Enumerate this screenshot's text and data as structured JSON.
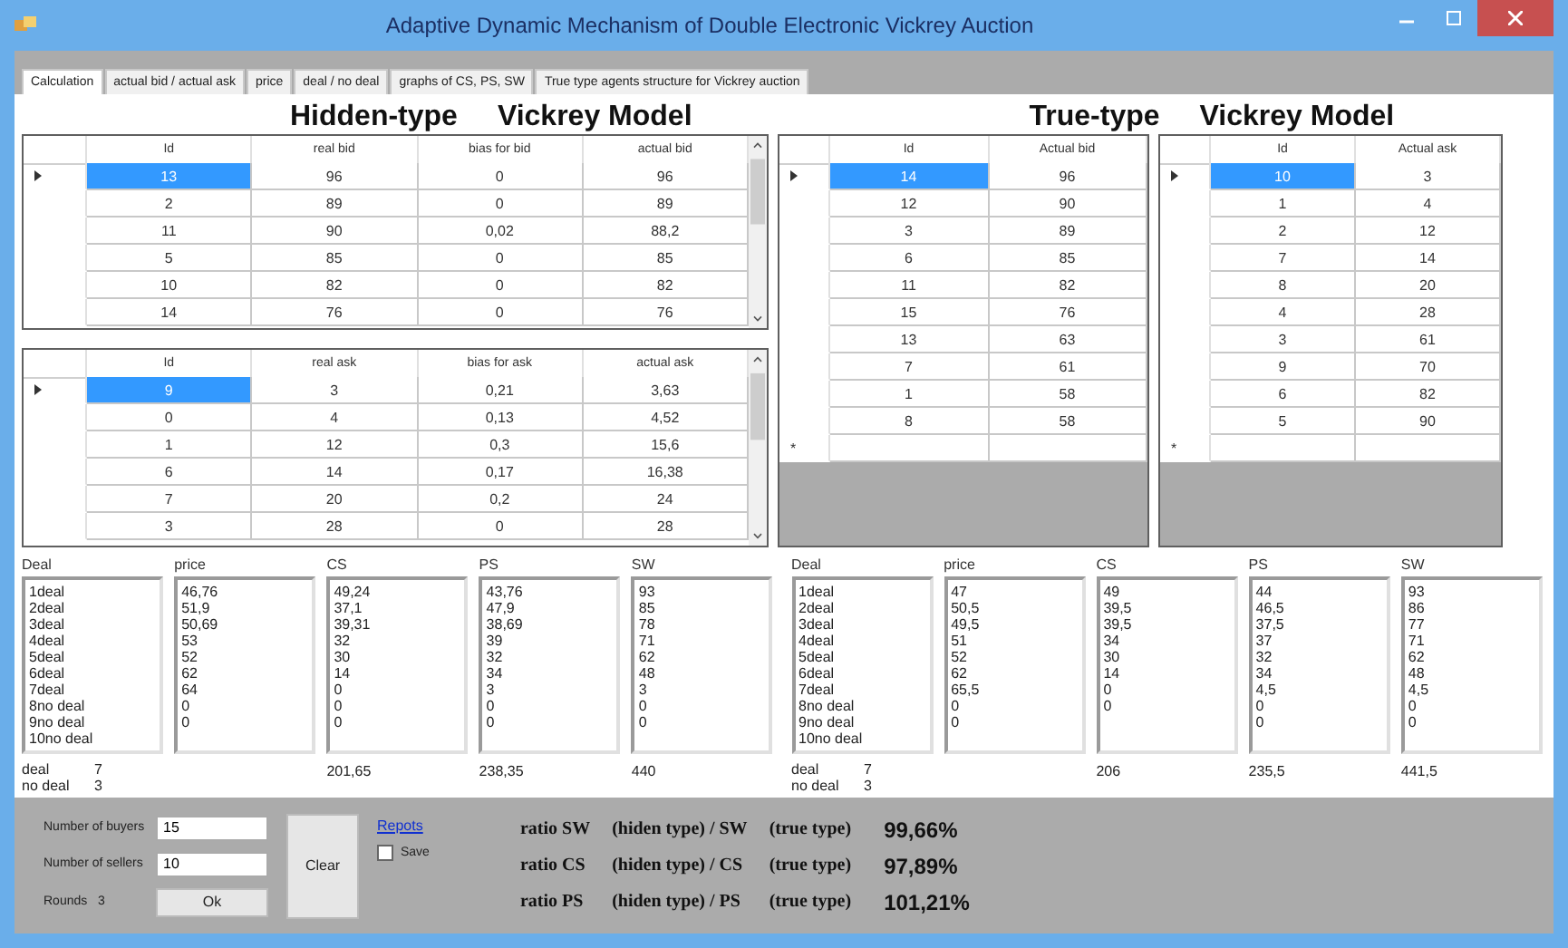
{
  "window": {
    "title": "Adaptive Dynamic Mechanism of Double Electronic Vickrey Auction"
  },
  "tabs": [
    {
      "label": "Calculation",
      "selected": true
    },
    {
      "label": "actual bid / actual ask",
      "selected": false
    },
    {
      "label": "price",
      "selected": false
    },
    {
      "label": "deal / no deal",
      "selected": false
    },
    {
      "label": "graphs of CS, PS, SW",
      "selected": false
    },
    {
      "label": "True type agents structure for Vickrey auction",
      "selected": false
    }
  ],
  "hidden_type": {
    "title": [
      "Hidden-type",
      "Vickrey Model"
    ],
    "bid_table": {
      "columns": [
        "Id",
        "real bid",
        "bias for bid",
        "actual bid"
      ],
      "rows": [
        {
          "cells": [
            "13",
            "96",
            "0",
            "96"
          ],
          "selected": true
        },
        {
          "cells": [
            "2",
            "89",
            "0",
            "89"
          ],
          "selected": false
        },
        {
          "cells": [
            "11",
            "90",
            "0,02",
            "88,2"
          ],
          "selected": false
        },
        {
          "cells": [
            "5",
            "85",
            "0",
            "85"
          ],
          "selected": false
        },
        {
          "cells": [
            "10",
            "82",
            "0",
            "82"
          ],
          "selected": false
        },
        {
          "cells": [
            "14",
            "76",
            "0",
            "76"
          ],
          "selected": false
        }
      ]
    },
    "ask_table": {
      "columns": [
        "Id",
        "real ask",
        "bias for ask",
        "actual ask"
      ],
      "rows": [
        {
          "cells": [
            "9",
            "3",
            "0,21",
            "3,63"
          ],
          "selected": true
        },
        {
          "cells": [
            "0",
            "4",
            "0,13",
            "4,52"
          ],
          "selected": false
        },
        {
          "cells": [
            "1",
            "12",
            "0,3",
            "15,6"
          ],
          "selected": false
        },
        {
          "cells": [
            "6",
            "14",
            "0,17",
            "16,38"
          ],
          "selected": false
        },
        {
          "cells": [
            "7",
            "20",
            "0,2",
            "24"
          ],
          "selected": false
        },
        {
          "cells": [
            "3",
            "28",
            "0",
            "28"
          ],
          "selected": false
        }
      ]
    }
  },
  "true_type": {
    "title": [
      "True-type",
      "Vickrey Model"
    ],
    "bid_table": {
      "columns": [
        "Id",
        "Actual bid"
      ],
      "new_row_marker": "*",
      "rows": [
        {
          "cells": [
            "14",
            "96"
          ],
          "selected": true
        },
        {
          "cells": [
            "12",
            "90"
          ],
          "selected": false
        },
        {
          "cells": [
            "3",
            "89"
          ],
          "selected": false
        },
        {
          "cells": [
            "6",
            "85"
          ],
          "selected": false
        },
        {
          "cells": [
            "11",
            "82"
          ],
          "selected": false
        },
        {
          "cells": [
            "15",
            "76"
          ],
          "selected": false
        },
        {
          "cells": [
            "13",
            "63"
          ],
          "selected": false
        },
        {
          "cells": [
            "7",
            "61"
          ],
          "selected": false
        },
        {
          "cells": [
            "1",
            "58"
          ],
          "selected": false
        },
        {
          "cells": [
            "8",
            "58"
          ],
          "selected": false
        }
      ]
    },
    "ask_table": {
      "columns": [
        "Id",
        "Actual ask"
      ],
      "new_row_marker": "*",
      "rows": [
        {
          "cells": [
            "10",
            "3"
          ],
          "selected": true
        },
        {
          "cells": [
            "1",
            "4"
          ],
          "selected": false
        },
        {
          "cells": [
            "2",
            "12"
          ],
          "selected": false
        },
        {
          "cells": [
            "7",
            "14"
          ],
          "selected": false
        },
        {
          "cells": [
            "8",
            "20"
          ],
          "selected": false
        },
        {
          "cells": [
            "4",
            "28"
          ],
          "selected": false
        },
        {
          "cells": [
            "3",
            "61"
          ],
          "selected": false
        },
        {
          "cells": [
            "9",
            "70"
          ],
          "selected": false
        },
        {
          "cells": [
            "6",
            "82"
          ],
          "selected": false
        },
        {
          "cells": [
            "5",
            "90"
          ],
          "selected": false
        }
      ]
    }
  },
  "results": [
    {
      "deal_label": "deal",
      "deal_count": "7",
      "no_deal_label": "no deal",
      "no_deal_count": "3",
      "lists": [
        {
          "header": "Deal",
          "items": [
            "1deal",
            "2deal",
            "3deal",
            "4deal",
            "5deal",
            "6deal",
            "7deal",
            "8no deal",
            "9no deal",
            "10no deal"
          ]
        },
        {
          "header": "price",
          "items": [
            "46,76",
            "51,9",
            "50,69",
            "53",
            "52",
            "62",
            "64",
            "0",
            "0"
          ]
        },
        {
          "header": "CS",
          "items": [
            "49,24",
            "37,1",
            "39,31",
            "32",
            "30",
            "14",
            "0",
            "0",
            "0"
          ],
          "total": "201,65"
        },
        {
          "header": "PS",
          "items": [
            "43,76",
            "47,9",
            "38,69",
            "39",
            "32",
            "34",
            "3",
            "0",
            "0"
          ],
          "total": "238,35"
        },
        {
          "header": "SW",
          "items": [
            "93",
            "85",
            "78",
            "71",
            "62",
            "48",
            "3",
            "0",
            "0"
          ],
          "total": "440"
        }
      ]
    },
    {
      "deal_label": "deal",
      "deal_count": "7",
      "no_deal_label": "no deal",
      "no_deal_count": "3",
      "lists": [
        {
          "header": "Deal",
          "items": [
            "1deal",
            "2deal",
            "3deal",
            "4deal",
            "5deal",
            "6deal",
            "7deal",
            "8no deal",
            "9no deal",
            "10no deal"
          ]
        },
        {
          "header": "price",
          "items": [
            "47",
            "50,5",
            "49,5",
            "51",
            "52",
            "62",
            "65,5",
            "0",
            "0"
          ]
        },
        {
          "header": "CS",
          "items": [
            "49",
            "39,5",
            "39,5",
            "34",
            "30",
            "14",
            "0",
            "0"
          ],
          "total": "206"
        },
        {
          "header": "PS",
          "items": [
            "44",
            "46,5",
            "37,5",
            "37",
            "32",
            "34",
            "4,5",
            "0",
            "0"
          ],
          "total": "235,5"
        },
        {
          "header": "SW",
          "items": [
            "93",
            "86",
            "77",
            "71",
            "62",
            "48",
            "4,5",
            "0",
            "0"
          ],
          "total": "441,5"
        }
      ]
    }
  ],
  "controls": {
    "fields": [
      {
        "label": "Number of buyers",
        "value": "15"
      },
      {
        "label": "Number of sellers",
        "value": "10"
      }
    ],
    "rounds": {
      "label": "Rounds",
      "value": "3"
    },
    "ok": "Ok",
    "clear": "Clear",
    "report_link": "Repots",
    "save": {
      "label": "Save",
      "checked": false
    }
  },
  "ratios": [
    {
      "parts": [
        "ratio SW",
        "(hiden type) / SW",
        "(true type)"
      ],
      "value": "99,66%"
    },
    {
      "parts": [
        "ratio CS",
        "(hiden type) / CS",
        "(true type)"
      ],
      "value": "97,89%"
    },
    {
      "parts": [
        "ratio PS",
        "(hiden type) / PS",
        "(true type)"
      ],
      "value": "101,21%"
    }
  ]
}
